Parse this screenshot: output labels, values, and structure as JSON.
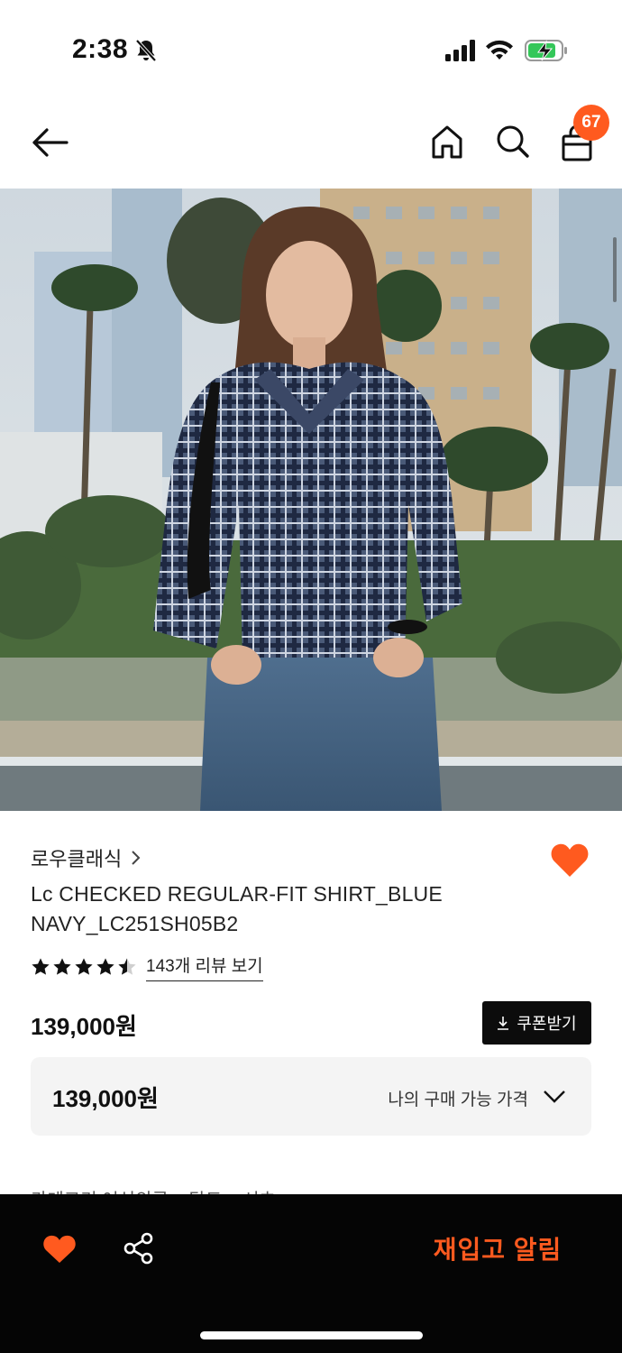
{
  "status_bar": {
    "time": "2:38",
    "icons": [
      "bell-slash-icon",
      "signal-icon",
      "wifi-icon",
      "battery-charging-icon"
    ]
  },
  "nav": {
    "icons": [
      "back-arrow-icon",
      "home-icon",
      "search-icon",
      "shopping-bag-icon"
    ],
    "cart_count": "67"
  },
  "product": {
    "brand": "로우클래식",
    "title": "Lc CHECKED REGULAR-FIT SHIRT_BLUE NAVY_LC251SH05B2",
    "rating": 4.5,
    "rating_max": 5,
    "review_link": "143개 리뷰 보기",
    "price": "139,000원",
    "coupon_label": "쿠폰받기",
    "my_price": "139,000원",
    "my_price_label": "나의 구매 가능 가격",
    "category_peek": "카테고리     여성의류  >  탑도  >  셔츠"
  },
  "bottom_bar": {
    "restock_label": "재입고 알림",
    "icons": [
      "heart-icon",
      "share-icon"
    ]
  },
  "colors": {
    "accent": "#ff5a1f",
    "dark": "#050505",
    "price_box_bg": "#f4f4f4"
  }
}
